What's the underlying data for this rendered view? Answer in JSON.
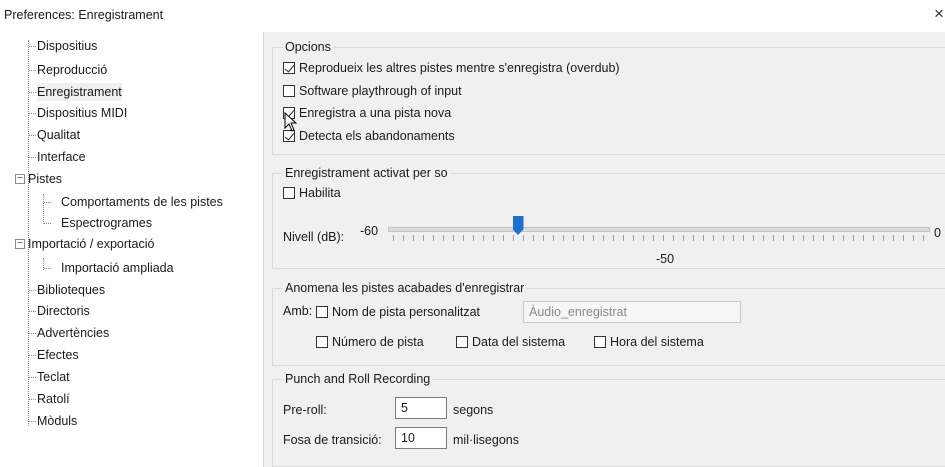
{
  "window": {
    "title": "Preferences: Enregistrament",
    "close_glyph": "×"
  },
  "tree": [
    "Dispositius",
    "Reproducció",
    "Enregistrament",
    "Dispositius MIDI",
    "Qualitat",
    "Interface",
    "Pistes",
    "Comportaments de les pistes",
    "Espectrogrames",
    "Importació / exportació",
    "Importació ampliada",
    "Biblioteques",
    "Directoris",
    "Advertències",
    "Efectes",
    "Teclat",
    "Ratolí",
    "Mòduls"
  ],
  "tree_expanders": [
    "−",
    "−"
  ],
  "options": {
    "title": "Opcions",
    "overdub": {
      "label": "Reprodueix les altres pistes mentre s'enregistra (overdub)",
      "checked": true
    },
    "playthrough": {
      "label": "Software playthrough of input",
      "checked": false
    },
    "new_track": {
      "label": "Enregistra a una pista nova",
      "checked": true
    },
    "dropouts": {
      "label": "Detecta els abandonaments",
      "checked": true
    }
  },
  "sound_activated": {
    "title": "Enregistrament activat per so",
    "enable": {
      "label": "Habilita",
      "checked": false
    },
    "level_label": "Nivell (dB):",
    "min_label": "-60",
    "max_label": "0",
    "value_label": "-50",
    "value_db": -50,
    "min_db": -60,
    "max_db": 0
  },
  "naming": {
    "title": "Anomena les pistes acabades d'enregistrar",
    "with_label": "Amb:",
    "custom_name": {
      "label": "Nom de pista personalitzat",
      "checked": false
    },
    "custom_value": "Àudio_enregistrat",
    "track_number": {
      "label": "Número de pista",
      "checked": false
    },
    "system_date": {
      "label": "Data del sistema",
      "checked": false
    },
    "system_time": {
      "label": "Hora del sistema",
      "checked": false
    }
  },
  "punch": {
    "title": "Punch and Roll Recording",
    "preroll_label": "Pre-roll:",
    "preroll_value": "5",
    "preroll_unit": "segons",
    "crossfade_label": "Fosa de transició:",
    "crossfade_value": "10",
    "crossfade_unit": "mil·lisegons"
  },
  "colors": {
    "accent": "#1e6fd0",
    "panel_bg": "#f0f0f0"
  }
}
